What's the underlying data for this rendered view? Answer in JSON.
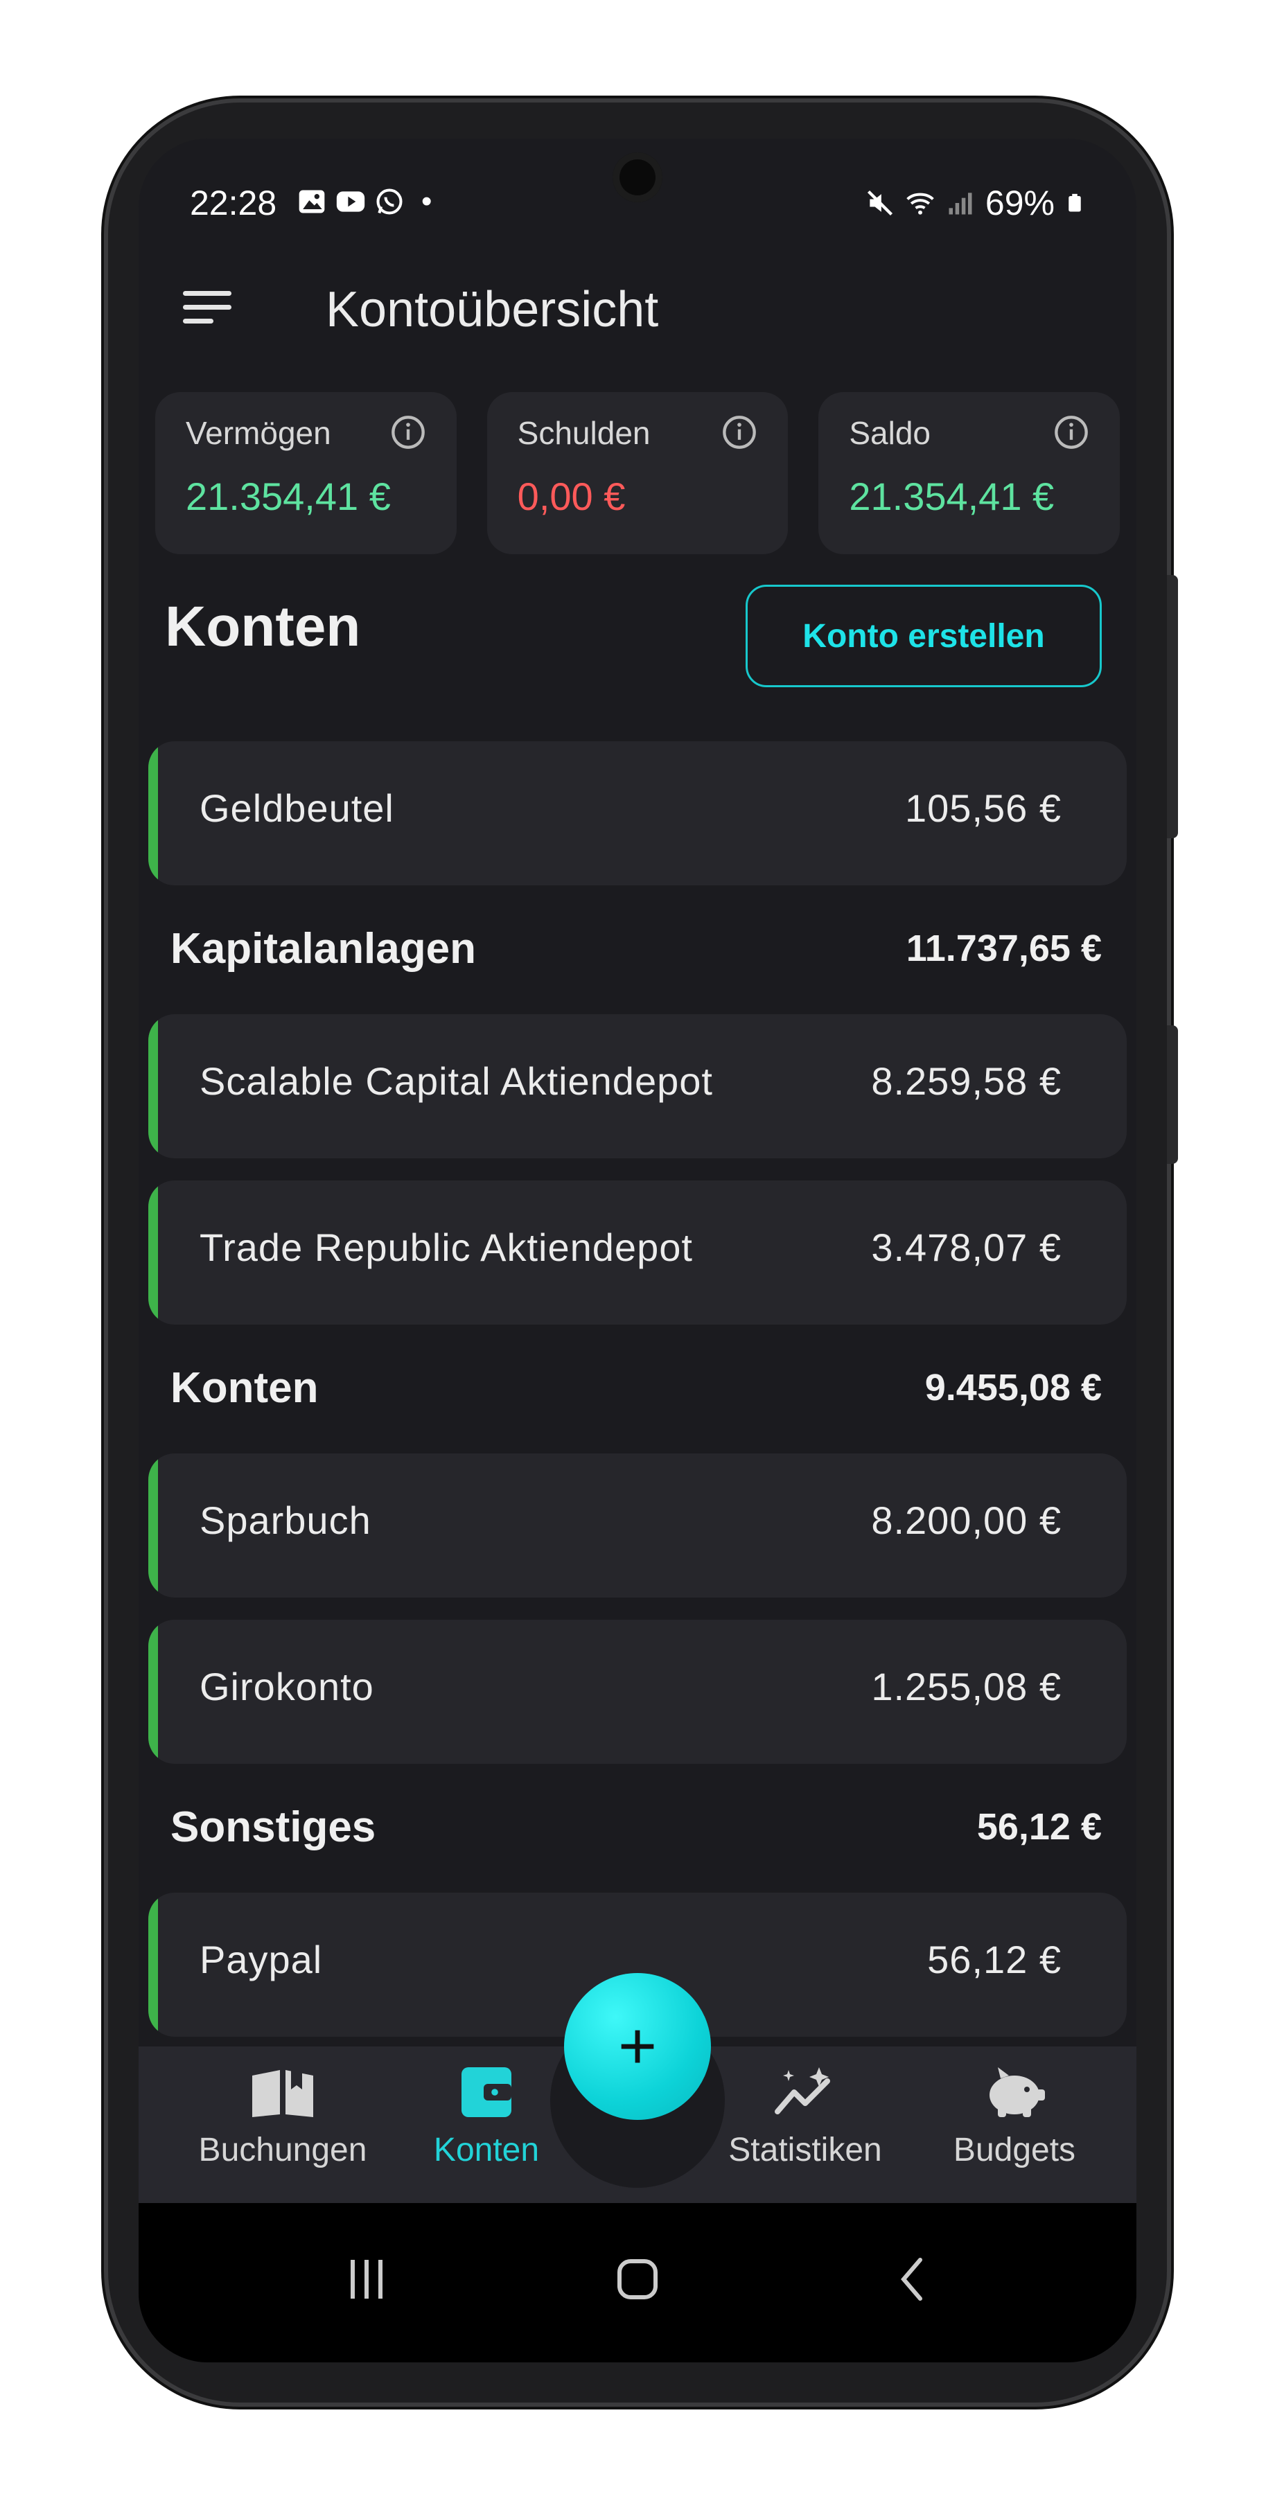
{
  "status": {
    "time": "22:28",
    "dot": "•",
    "battery": "69%"
  },
  "appbar": {
    "title": "Kontoübersicht"
  },
  "summary": [
    {
      "label": "Vermögen",
      "value": "21.354,41 €",
      "color": "#5ee3a0"
    },
    {
      "label": "Schulden",
      "value": "0,00 €",
      "color": "#ff5a5a"
    },
    {
      "label": "Saldo",
      "value": "21.354,41 €",
      "color": "#5ee3a0"
    }
  ],
  "main": {
    "title": "Konten",
    "create_label": "Konto erstellen"
  },
  "accounts": {
    "geldbeutel": {
      "name": "Geldbeutel",
      "amount": "105,56 €"
    },
    "kapitalanlagen": {
      "name": "Kapitalanlagen",
      "total": "11.737,65 €"
    },
    "scalable": {
      "name": "Scalable Capital Aktiendepot",
      "amount": "8.259,58 €"
    },
    "trade_republic": {
      "name": "Trade Republic Aktiendepot",
      "amount": "3.478,07 €"
    },
    "konten": {
      "name": "Konten",
      "total": "9.455,08 €"
    },
    "sparbuch": {
      "name": "Sparbuch",
      "amount": "8.200,00 €"
    },
    "girokonto": {
      "name": "Girokonto",
      "amount": "1.255,08 €"
    },
    "sonstiges": {
      "name": "Sonstiges",
      "total": "56,12 €"
    },
    "paypal": {
      "name": "Paypal",
      "amount": "56,12 €"
    }
  },
  "nav": {
    "items": [
      {
        "label": "Buchungen",
        "icon": "book-icon"
      },
      {
        "label": "Konten",
        "icon": "wallet-icon",
        "active": true
      },
      {
        "label": "Statistiken",
        "icon": "chart-sparkle-icon"
      },
      {
        "label": "Budgets",
        "icon": "piggy-bank-icon"
      }
    ],
    "fab": "+"
  },
  "colors": {
    "accent": "#1ee3e8",
    "positive": "#5ee3a0",
    "negative": "#ff5a5a",
    "account_bar": "#3eb34a"
  }
}
